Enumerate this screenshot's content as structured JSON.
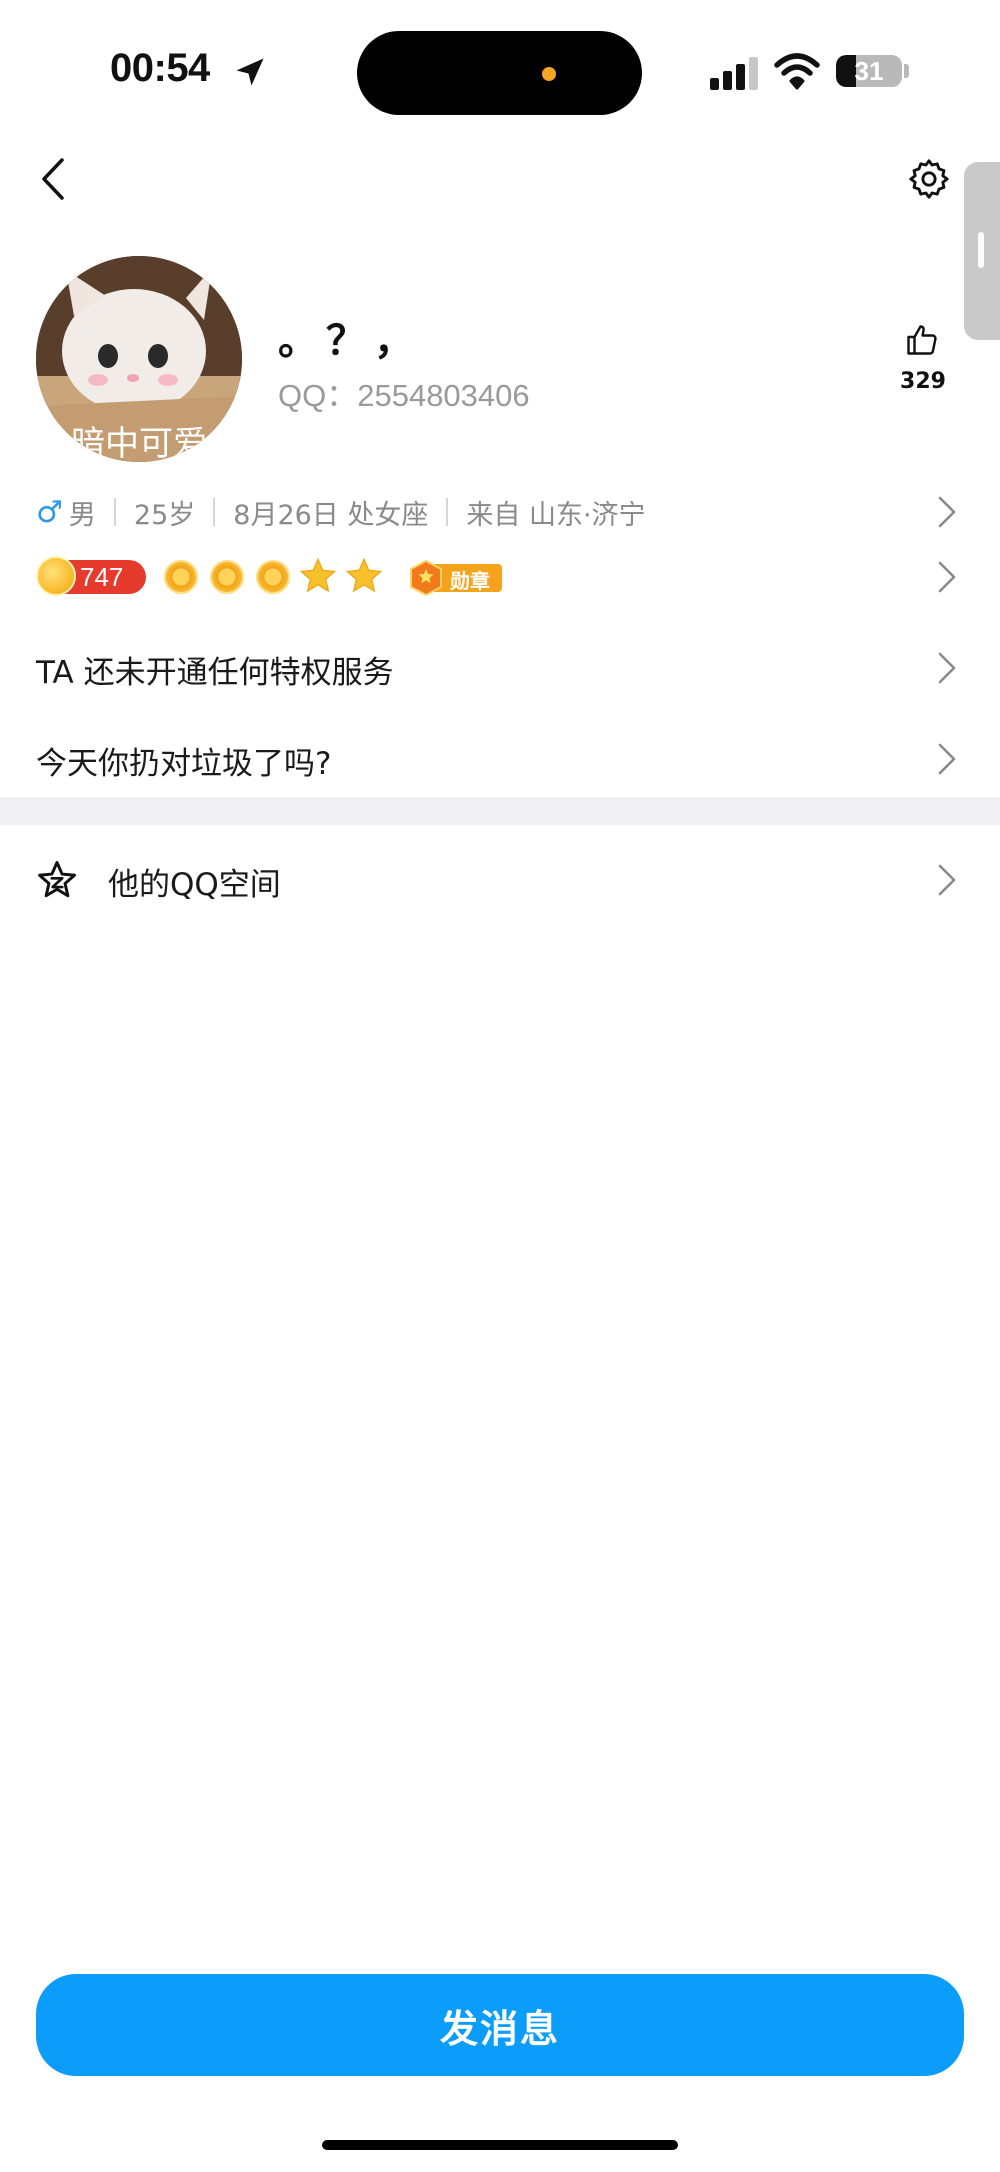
{
  "status_bar": {
    "time": "00:54",
    "battery_percent": "31",
    "battery_level": 0.31,
    "island_dot_color": "#f5a623"
  },
  "nav": {
    "back_icon": "chevron-left-icon",
    "settings_icon": "gear-icon"
  },
  "profile": {
    "avatar_caption": "暗中可爱",
    "nickname": "。？，",
    "qq_label": "QQ：2554803406",
    "like_count": "329"
  },
  "info": {
    "gender_symbol": "♂",
    "gender": "男",
    "age": "25岁",
    "birthday": "8月26日 处女座",
    "location": "来自 山东·济宁"
  },
  "badges": {
    "level": "747",
    "medal_label": "勋章",
    "sun_count": 3,
    "star_count": 2
  },
  "menu": {
    "privilege": "TA 还未开通任何特权服务",
    "status_question": "今天你扔对垃圾了吗?",
    "qzone": "他的QQ空间"
  },
  "actions": {
    "send_message": "发消息"
  },
  "colors": {
    "accent_blue": "#0c9dfb",
    "level_red": "#e63a2c",
    "gender_blue": "#2f96e8"
  }
}
